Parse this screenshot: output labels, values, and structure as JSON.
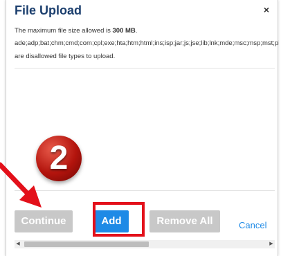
{
  "dialog": {
    "title": "File Upload",
    "close_icon": "×",
    "info": {
      "max_size_prefix": "The maximum file size allowed is ",
      "max_size_value": "300 MB",
      "max_size_suffix": ".",
      "disallowed_types": "ade;adp;bat;chm;cmd;com;cpl;exe;hta;htm;html;ins;isp;jar;js;jse;lib;lnk;mde;msc;msp;mst;pif;scr;sct;shb;sys;vb;vbe;vbs;vxd;wsc;wsf;wsh",
      "disallowed_suffix": "are disallowed file types to upload."
    },
    "buttons": {
      "continue": "Continue",
      "add": "Add",
      "remove_all": "Remove All",
      "cancel": "Cancel"
    }
  },
  "annotation": {
    "step_number": "2",
    "arrow_color": "#e3101a",
    "highlight_color": "#e3101a"
  },
  "colors": {
    "title": "#1c3f6e",
    "primary_button": "#1e8ae6",
    "disabled_button": "#c8c8c8",
    "link": "#1e8ae6"
  }
}
